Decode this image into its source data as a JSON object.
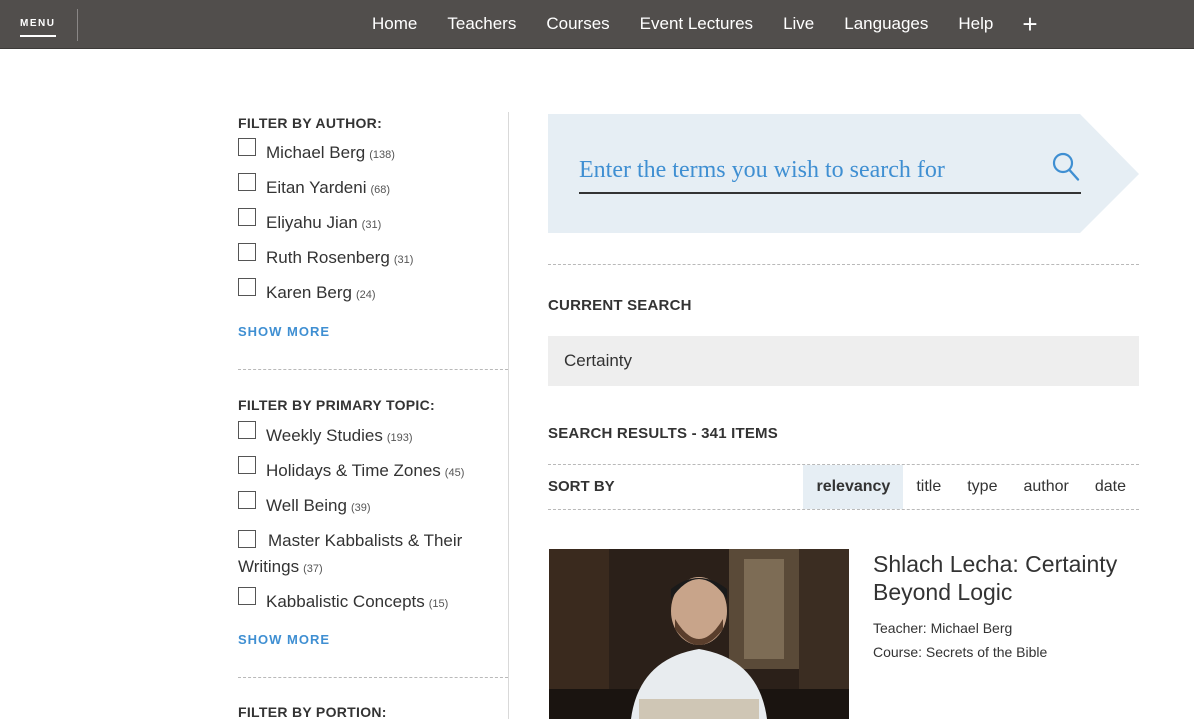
{
  "nav": {
    "menu_label": "MENU",
    "items": [
      "Home",
      "Teachers",
      "Courses",
      "Event Lectures",
      "Live",
      "Languages",
      "Help"
    ],
    "plus_label": "+"
  },
  "filters": {
    "author": {
      "title": "FILTER BY AUTHOR:",
      "items": [
        {
          "label": "Michael Berg",
          "count": "(138)"
        },
        {
          "label": "Eitan Yardeni",
          "count": "(68)"
        },
        {
          "label": "Eliyahu Jian",
          "count": "(31)"
        },
        {
          "label": "Ruth Rosenberg",
          "count": "(31)"
        },
        {
          "label": "Karen Berg",
          "count": "(24)"
        }
      ],
      "show_more": "SHOW MORE"
    },
    "topic": {
      "title": "FILTER BY PRIMARY TOPIC:",
      "items": [
        {
          "label": "Weekly Studies",
          "count": "(193)"
        },
        {
          "label": "Holidays & Time Zones",
          "count": "(45)"
        },
        {
          "label": "Well Being",
          "count": "(39)"
        },
        {
          "label": "Master Kabbalists & Their Writings",
          "count": "(37)"
        },
        {
          "label": "Kabbalistic Concepts",
          "count": "(15)"
        }
      ],
      "show_more": "SHOW MORE"
    },
    "portion": {
      "title": "FILTER BY PORTION:"
    }
  },
  "search": {
    "placeholder": "Enter the terms you wish to search for",
    "icon": "search-icon"
  },
  "current_search": {
    "label": "CURRENT SEARCH",
    "value": "Certainty"
  },
  "results": {
    "label": "SEARCH RESULTS - 341 ITEMS",
    "sort_label": "SORT BY",
    "sort_options": [
      "relevancy",
      "title",
      "type",
      "author",
      "date"
    ],
    "active_sort": "relevancy",
    "items": [
      {
        "title": "Shlach Lecha: Certainty Beyond Logic",
        "teacher": "Teacher: Michael Berg",
        "course": "Course: Secrets of the Bible"
      }
    ]
  },
  "colors": {
    "nav_bg": "#514e4c",
    "accent_blue": "#3f8fd2",
    "search_bg": "#e6eef4",
    "current_search_bg": "#eeeeee"
  }
}
